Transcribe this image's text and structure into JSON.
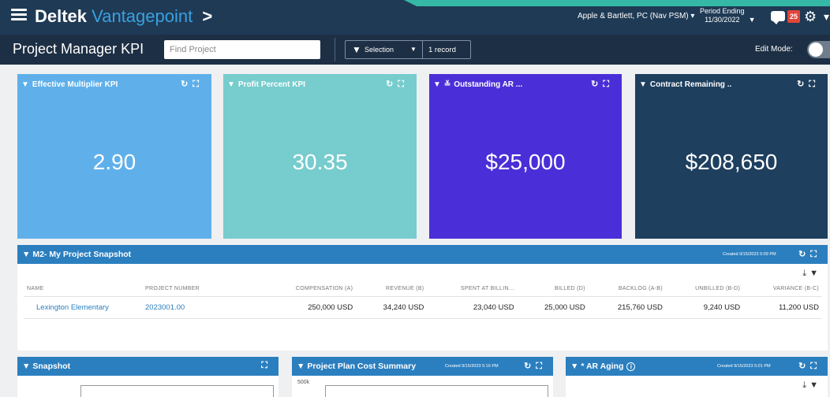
{
  "app": {
    "brand_name": "Deltek",
    "brand_product": "Vantagepoint",
    "brand_chevron": ">",
    "company": "Apple & Bartlett, PC (Nav PSM) ▾",
    "period_label": "Period Ending",
    "period_value": "11/30/2022",
    "notification_count": "25"
  },
  "subbar": {
    "page_title": "Project Manager KPI",
    "find_placeholder": "Find Project",
    "filter_label": "Selection",
    "record_count": "1 record",
    "edit_mode_label": "Edit Mode:"
  },
  "kpi_cards": [
    {
      "title": "Effective Multiplier KPI",
      "value": "2.90",
      "color": "#5fb0ea"
    },
    {
      "title": "Profit Percent KPI",
      "value": "30.35",
      "color": "#77cccd"
    },
    {
      "title": "Outstanding AR ...",
      "value": "$25,000",
      "color": "#4a2fd8"
    },
    {
      "title": "Contract Remaining ..",
      "value": "$208,650",
      "color": "#1e3f5e"
    }
  ],
  "snapshot_panel": {
    "title": "M2- My Project Snapshot",
    "created": "Created 9/15/2023 5:09 PM",
    "columns": [
      "NAME",
      "PROJECT NUMBER",
      "COMPENSATION (A)",
      "REVENUE (B)",
      "SPENT AT BILLIN...",
      "BILLED (D)",
      "BACKLOG (A-B)",
      "UNBILLED (B-D)",
      "VARIANCE (B-C)"
    ],
    "rows": [
      [
        "Lexington Elementary",
        "2023001.00",
        "250,000 USD",
        "34,240 USD",
        "23,040 USD",
        "25,000 USD",
        "215,760 USD",
        "9,240 USD",
        "11,200 USD"
      ]
    ]
  },
  "bottom_panels": [
    {
      "title": "Snapshot",
      "created": ""
    },
    {
      "title": "Project Plan Cost Summary",
      "created": "Created 9/15/2023 5:16 PM",
      "y_tick": "500k"
    },
    {
      "title": "* AR Aging",
      "created": "Created 9/15/2023 5:01 PM"
    }
  ],
  "colors": {
    "topbar": "#1f3a55",
    "subbar": "#1d2f44",
    "panel_header": "#2b7fbf",
    "link": "#2b7fbf",
    "accent": "#35b9a6",
    "badge": "#e0453a"
  },
  "icons": [
    "hamburger-icon",
    "chat-icon",
    "gear-icon",
    "filter-icon",
    "refresh-icon",
    "expand-icon",
    "export-icon",
    "info-icon"
  ]
}
